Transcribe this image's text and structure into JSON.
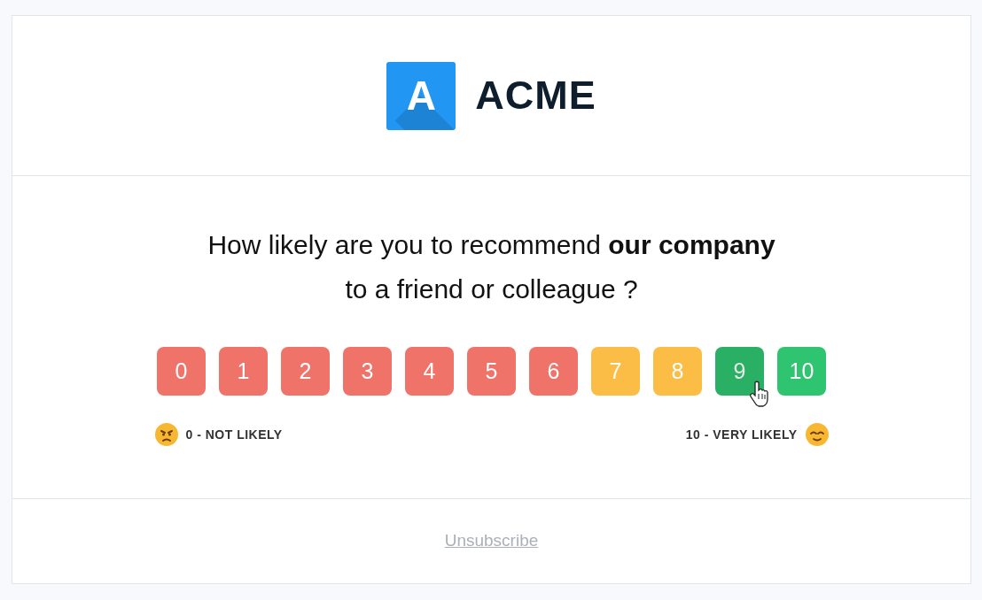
{
  "logo": {
    "mark": "A",
    "name": "ACME"
  },
  "question": "How likely are you to recommend **our company**\nto a friend or colleague ?",
  "scores": [
    {
      "label": "0",
      "color": "#f0736a",
      "hovered": false
    },
    {
      "label": "1",
      "color": "#f0736a",
      "hovered": false
    },
    {
      "label": "2",
      "color": "#f0736a",
      "hovered": false
    },
    {
      "label": "3",
      "color": "#f0736a",
      "hovered": false
    },
    {
      "label": "4",
      "color": "#f0736a",
      "hovered": false
    },
    {
      "label": "5",
      "color": "#f0736a",
      "hovered": false
    },
    {
      "label": "6",
      "color": "#f0736a",
      "hovered": false
    },
    {
      "label": "7",
      "color": "#fbbd45",
      "hovered": false
    },
    {
      "label": "8",
      "color": "#fbbd45",
      "hovered": false
    },
    {
      "label": "9",
      "color": "#2fc46f",
      "hovered": true
    },
    {
      "label": "10",
      "color": "#2fc46f",
      "hovered": false
    }
  ],
  "scale_labels": {
    "low": "0 - NOT LIKELY",
    "high": "10 - VERY LIKELY"
  },
  "footer": {
    "link": "Unsubscribe"
  }
}
